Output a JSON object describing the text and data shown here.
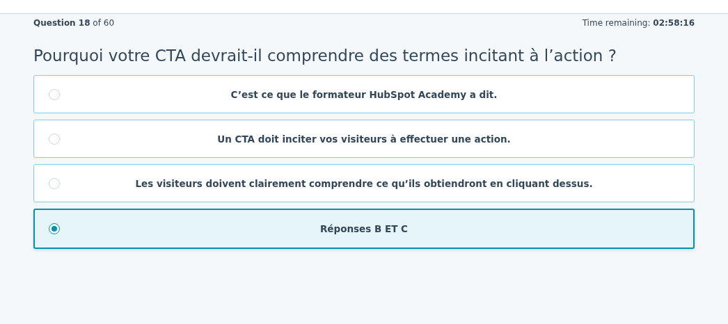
{
  "progress": "**Question 18** of 60",
  "timer": "Time remaining: **02:58:16**",
  "question": "Pourquoi votre CTA devrait-il comprendre des termes incitant à l’action ?",
  "options": [
    {
      "label": "C’est ce que le formateur HubSpot Academy a dit.",
      "selected": false
    },
    {
      "label": "Un CTA doit inciter vos visiteurs à effectuer une action.",
      "selected": false
    },
    {
      "label": "Les visiteurs doivent clairement comprendre ce qu’ils obtiendront en cliquant dessus.",
      "selected": false
    },
    {
      "label": "Réponses B ET C",
      "selected": true
    }
  ]
}
